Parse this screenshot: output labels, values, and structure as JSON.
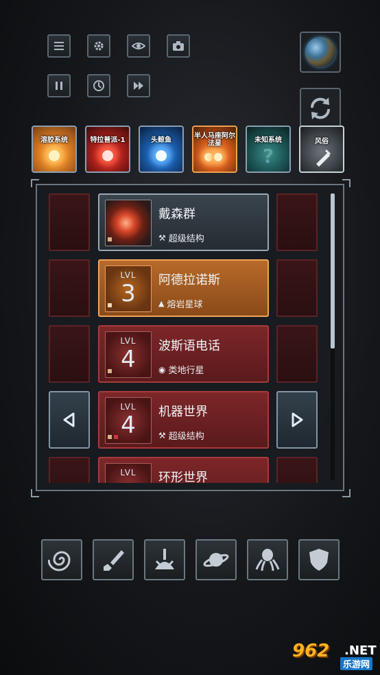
{
  "toolbar": {
    "top_row": [
      "menu-icon",
      "gear-icon",
      "eye-icon",
      "camera-icon"
    ],
    "second_row": [
      "pause-icon",
      "clock-icon",
      "fast-forward-icon"
    ]
  },
  "tabs": [
    {
      "label": "溶胶系统",
      "color": "#e8892a",
      "orb": "#ffd27a"
    },
    {
      "label": "特拉普派-1",
      "color": "#b2221d",
      "orb": "#ffd2c8"
    },
    {
      "label": "头鲸鱼",
      "color": "#1b5fb0",
      "orb": "#e6f5ff"
    },
    {
      "label": "半人马座阿尔法星",
      "color": "#d95f1d",
      "orb": "#ffe9a8"
    },
    {
      "label": "未知系统",
      "color": "#1f5a5a",
      "orb": "#7fc0c0"
    },
    {
      "label": "风俗",
      "color": "#5a5f65",
      "orb": ""
    }
  ],
  "list": {
    "items": [
      {
        "name": "戴森群",
        "type": "超级结构",
        "type_icon": "wrench-icon",
        "level": "",
        "style": "selected-gray"
      },
      {
        "name": "阿德拉诺斯",
        "type": "熔岩星球",
        "type_icon": "volcano-icon",
        "level": "3",
        "level_label": "LVL",
        "style": "orange"
      },
      {
        "name": "波斯语电话",
        "type": "类地行星",
        "type_icon": "earth-icon",
        "level": "4",
        "level_label": "LVL",
        "style": "red"
      },
      {
        "name": "机器世界",
        "type": "超级结构",
        "type_icon": "wrench-icon",
        "level": "4",
        "level_label": "LVL",
        "style": "red"
      },
      {
        "name": "环形世界",
        "type": "",
        "type_icon": "",
        "level": "",
        "level_label": "LVL",
        "style": "red"
      }
    ]
  },
  "bottom_bar": [
    "galaxy-icon",
    "dagger-icon",
    "impact-icon",
    "ufo-icon",
    "octopus-icon",
    "shield-icon"
  ],
  "watermark": {
    "num": "962",
    "net": ".NET",
    "cn": "乐游网"
  },
  "colors": {
    "accent_orange": "#e88a2a",
    "card_red": "#7a2528",
    "frame": "#6a7680"
  }
}
